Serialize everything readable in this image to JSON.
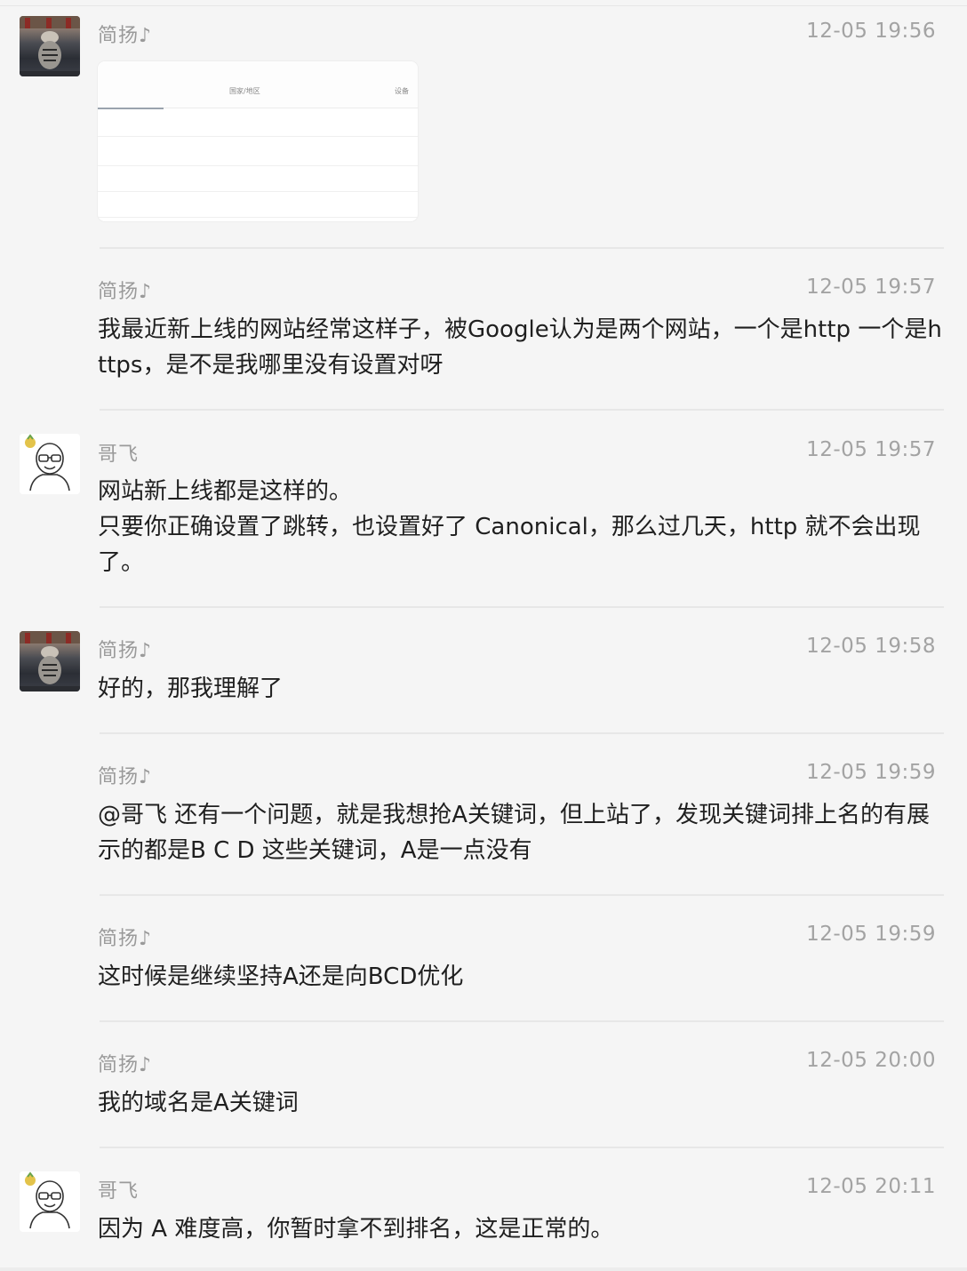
{
  "messages": [
    {
      "sender": "简扬♪",
      "time": "12-05 19:56",
      "type": "image",
      "image": {
        "col1": "国家/地区",
        "col2": "设备"
      }
    },
    {
      "sender": "简扬♪",
      "time": "12-05 19:57",
      "text": "我最近新上线的网站经常这样子，被Google认为是两个网站，一个是http 一个是https，是不是我哪里没有设置对呀"
    },
    {
      "sender": "哥飞",
      "time": "12-05 19:57",
      "text": "网站新上线都是这样的。\n只要你正确设置了跳转，也设置好了 Canonical，那么过几天，http 就不会出现了。"
    },
    {
      "sender": "简扬♪",
      "time": "12-05 19:58",
      "text": "好的，那我理解了"
    },
    {
      "sender": "简扬♪",
      "time": "12-05 19:59",
      "text": "@哥飞 还有一个问题，就是我想抢A关键词，但上站了，发现关键词排上名的有展示的都是B C D 这些关键词，A是一点没有"
    },
    {
      "sender": "简扬♪",
      "time": "12-05 19:59",
      "text": "这时候是继续坚持A还是向BCD优化"
    },
    {
      "sender": "简扬♪",
      "time": "12-05 20:00",
      "text": "我的域名是A关键词"
    },
    {
      "sender": "哥飞",
      "time": "12-05 20:11",
      "text": "因为 A 难度高，你暂时拿不到排名，这是正常的。"
    }
  ],
  "icons": {
    "tiger_avatar": "tiger-reflection-avatar",
    "cartoon_avatar": "bald-man-glasses-avatar"
  }
}
